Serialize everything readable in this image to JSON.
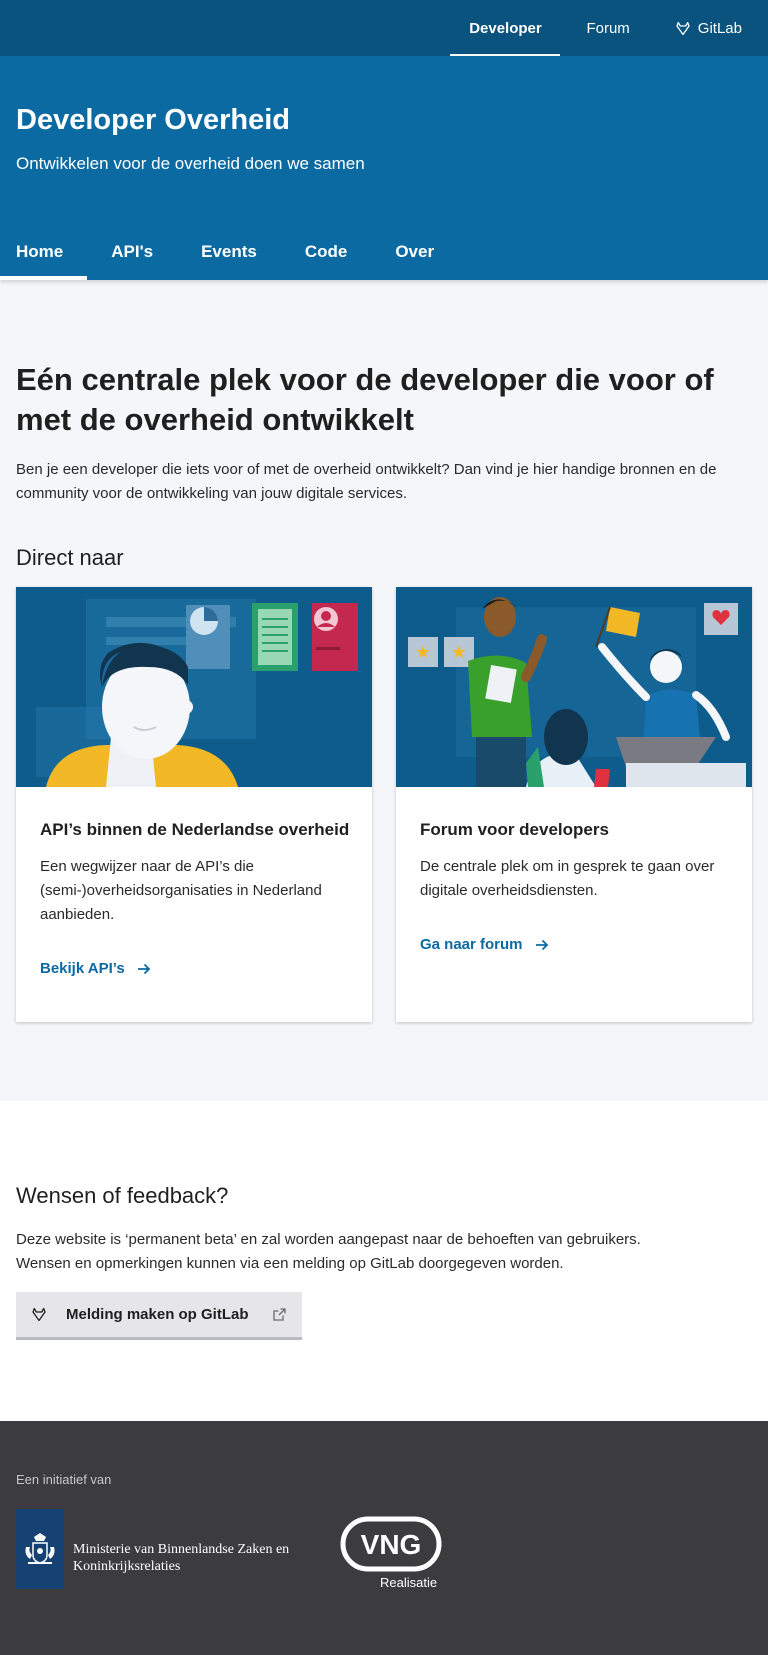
{
  "topnav": {
    "items": [
      {
        "label": "Developer"
      },
      {
        "label": "Forum"
      },
      {
        "label": "GitLab",
        "icon": "gitlab-icon"
      }
    ]
  },
  "hero": {
    "title": "Developer Overheid",
    "subtitle": "Ontwikkelen voor de overheid doen we samen"
  },
  "mainnav": {
    "items": [
      {
        "label": "Home"
      },
      {
        "label": "API's"
      },
      {
        "label": "Events"
      },
      {
        "label": "Code"
      },
      {
        "label": "Over"
      }
    ]
  },
  "intro": {
    "heading": "Eén centrale plek voor de developer die voor of met de overheid ontwikkelt",
    "text": "Ben je een developer die iets voor of met de overheid ontwikkelt? Dan vind je hier handige bronnen en de community voor de ontwikkeling van jouw digitale services."
  },
  "direct": {
    "title": "Direct naar",
    "cards": [
      {
        "title": "API’s binnen de Nederlandse overheid",
        "text": "Een wegwijzer naar de API’s die (semi-)overheidsorganisaties in Nederland aanbieden.",
        "link": "Bekijk API’s"
      },
      {
        "title": "Forum voor developers",
        "text": "De centrale plek om in gesprek te gaan over digitale overheidsdiensten.",
        "link": "Ga naar forum"
      }
    ]
  },
  "feedback": {
    "title": "Wensen of feedback?",
    "line1": "Deze website is ‘permanent beta’ en zal worden aangepast naar de behoeften van gebruikers.",
    "line2": "Wensen en opmerkingen kunnen via een melding op GitLab doorgegeven worden.",
    "button": "Melding maken op GitLab"
  },
  "footer": {
    "label": "Een initiatief van",
    "ministry_line1": "Ministerie van Binnenlandse Zaken en",
    "ministry_line2": "Koninkrijksrelaties",
    "vng": "VNG",
    "vng_sub": "Realisatie"
  },
  "colors": {
    "topbar": "#09537e",
    "hero": "#0b6aa2",
    "link": "#0b6aa2",
    "footer": "#3c3c3f"
  }
}
